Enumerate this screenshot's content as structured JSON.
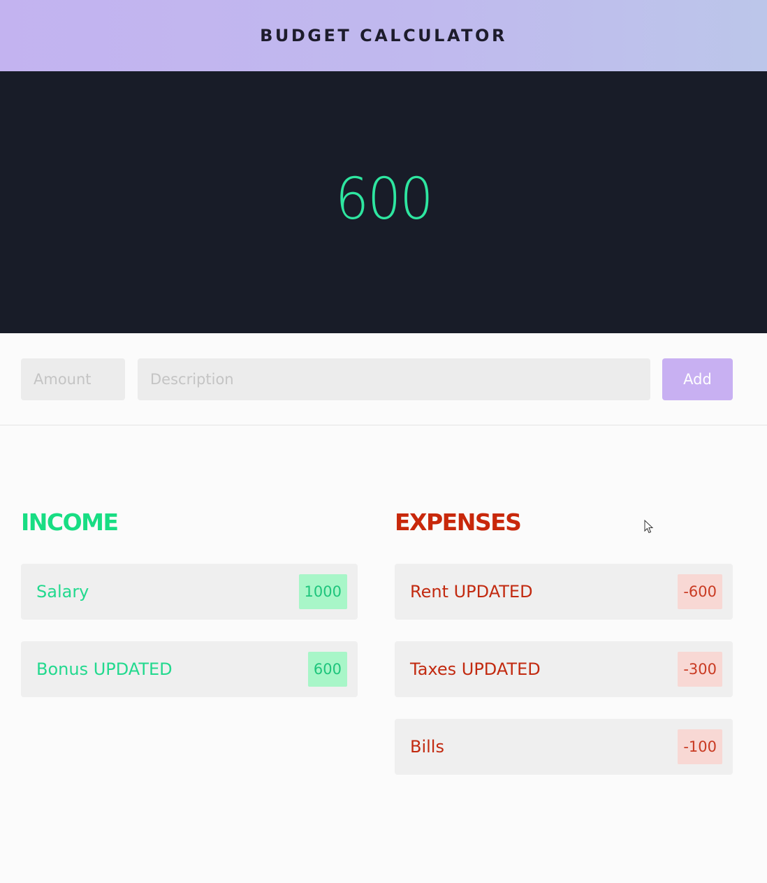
{
  "header": {
    "title": "BUDGET CALCULATOR"
  },
  "total": {
    "value": "600"
  },
  "form": {
    "amount_placeholder": "Amount",
    "description_placeholder": "Description",
    "add_label": "Add"
  },
  "income": {
    "heading": "INCOME",
    "items": [
      {
        "label": "Salary",
        "value": "1000"
      },
      {
        "label": "Bonus UPDATED",
        "value": "600"
      }
    ]
  },
  "expenses": {
    "heading": "EXPENSES",
    "items": [
      {
        "label": "Rent UPDATED",
        "value": "-600"
      },
      {
        "label": "Taxes UPDATED",
        "value": "-300"
      },
      {
        "label": "Bills",
        "value": "-100"
      }
    ]
  },
  "colors": {
    "header_gradient_start": "#c3b3f0",
    "header_gradient_end": "#bcc6ea",
    "total_panel_bg": "#181c28",
    "total_text": "#2ee6a0",
    "income_accent": "#18dd83",
    "expense_accent": "#c8280b",
    "add_button": "#c8b0f2"
  },
  "icons": {
    "cursor": "mouse-pointer-icon"
  }
}
